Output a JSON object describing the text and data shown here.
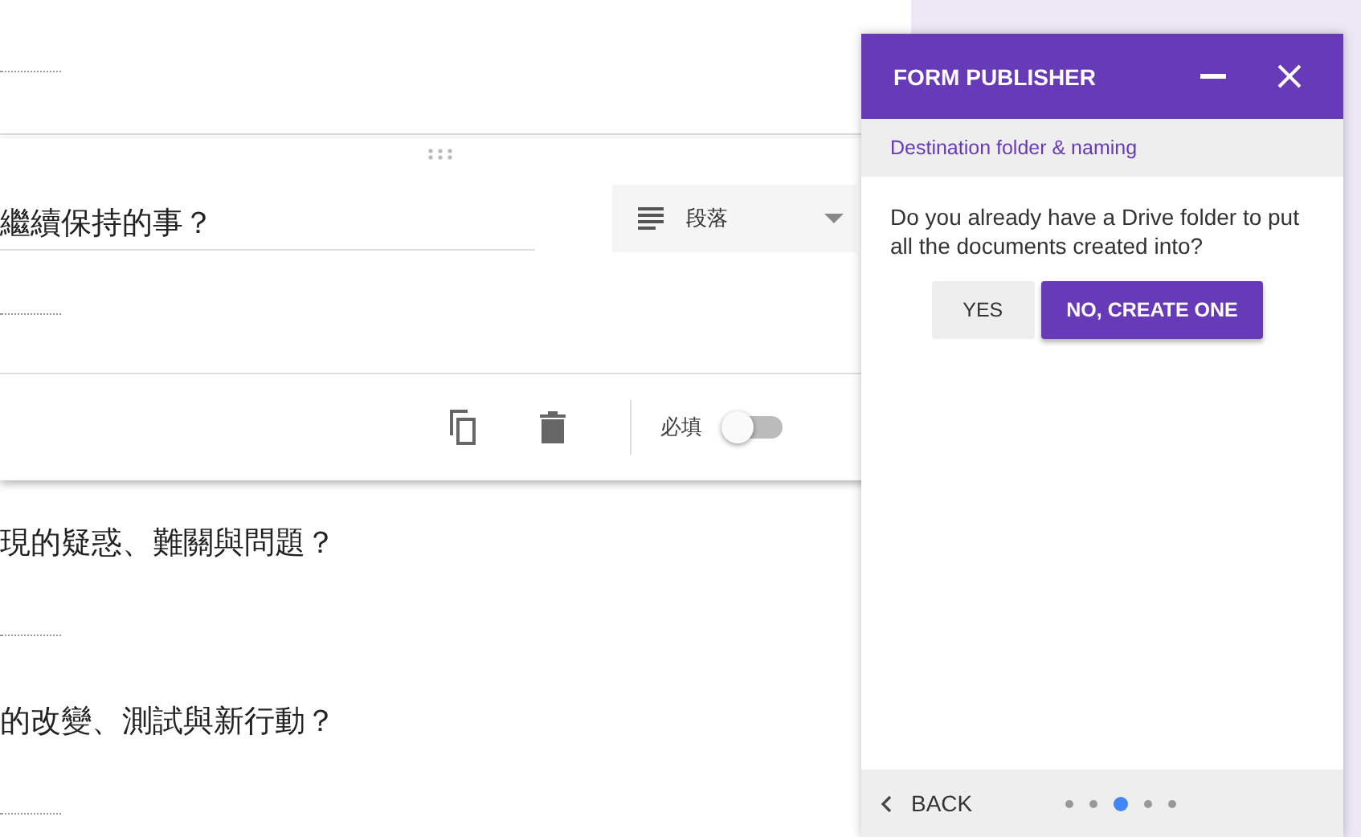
{
  "form": {
    "questions": [
      {
        "title": "繼續保持的事？",
        "active": true,
        "type_label": "段落",
        "required_label": "必填",
        "required": false
      },
      {
        "title": "現的疑惑、難關與問題？",
        "active": false
      },
      {
        "title": "的改變、測試與新行動？",
        "active": false
      }
    ]
  },
  "panel": {
    "title": "FORM PUBLISHER",
    "subtitle": "Destination folder & naming",
    "question": "Do you already have a Drive folder to put all the documents created into?",
    "buttons": [
      {
        "label": "YES",
        "kind": "secondary"
      },
      {
        "label": "NO, CREATE ONE",
        "kind": "primary"
      }
    ],
    "back": "BACK",
    "steps": [
      {
        "selected": false
      },
      {
        "selected": false
      },
      {
        "selected": true
      },
      {
        "selected": false
      },
      {
        "selected": false
      }
    ]
  }
}
